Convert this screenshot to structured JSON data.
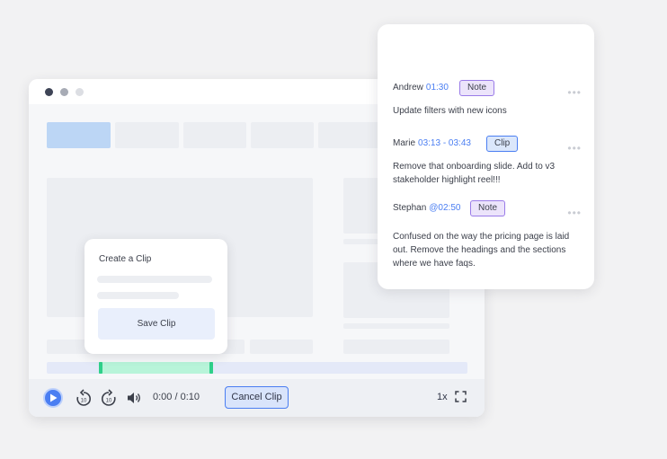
{
  "player": {
    "time": "0:00 / 0:10",
    "cancel_clip_label": "Cancel Clip",
    "speed": "1x",
    "clip_range_start": 0.124,
    "clip_range_end": 0.395
  },
  "clip_card": {
    "title": "Create a Clip",
    "save_label": "Save Clip"
  },
  "comments": [
    {
      "name": "Andrew",
      "time": "01:30",
      "badge": "Note",
      "badge_type": "note",
      "more": "•••",
      "text": "Update filters with new icons"
    },
    {
      "name": "Marie",
      "time": "03:13 - 03:43",
      "badge": "Clip",
      "badge_type": "clip",
      "more": "•••",
      "text": "Remove that onboarding slide. Add to v3 stakeholder highlight reel!!!"
    },
    {
      "name": "Stephan",
      "time": "@02:50",
      "badge": "Note",
      "badge_type": "note",
      "more": "•••",
      "text": "Confused on the way the pricing page is laid out. Remove the headings and the sections where we have faqs."
    }
  ],
  "colors": {
    "accent": "#4a7ef2",
    "clip_range": "#b8f4d9",
    "clip_handle": "#2fd08a",
    "note_badge": "#ece4fb"
  },
  "icons": [
    "play-icon",
    "rewind-10-icon",
    "forward-10-icon",
    "volume-icon",
    "fullscreen-icon",
    "more-icon"
  ]
}
